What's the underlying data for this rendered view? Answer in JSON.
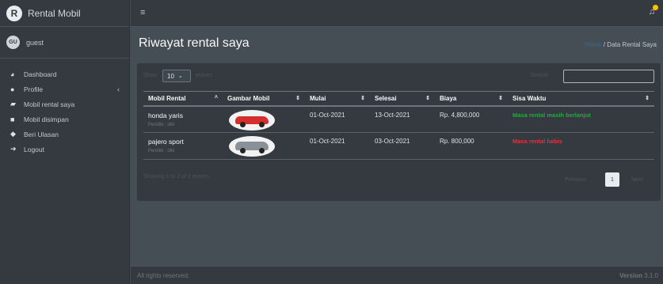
{
  "brand": {
    "name": "Rental Mobil",
    "logo_letter": "R"
  },
  "user": {
    "initials": "GU",
    "name": "guest"
  },
  "sidebar": {
    "items": [
      {
        "label": "Dashboard",
        "icon": "tachometer-icon"
      },
      {
        "label": "Profile",
        "icon": "user-icon",
        "arrow": "‹"
      },
      {
        "label": "Mobil rental saya",
        "icon": "car-icon"
      },
      {
        "label": "Mobil disimpan",
        "icon": "bookmark-icon"
      },
      {
        "label": "Beri Ulasan",
        "icon": "comments-icon"
      },
      {
        "label": "Logout",
        "icon": "sign-out-icon"
      }
    ]
  },
  "topbar": {
    "menu_icon": "≡",
    "bell_icon": "bell-icon"
  },
  "header": {
    "title": "Riwayat rental saya",
    "breadcrumb_home": "Home",
    "breadcrumb_sep": "/",
    "breadcrumb_current": "Data Rental Saya"
  },
  "table_controls": {
    "length_label": "Show",
    "length_value": "10",
    "length_after": "entries",
    "search_label": "Search:"
  },
  "table": {
    "columns": [
      "Mobil Rental",
      "Gambar Mobil",
      "Mulai",
      "Selesai",
      "Biaya",
      "Sisa Waktu"
    ],
    "rows": [
      {
        "name": "honda yaris",
        "owner": "Pemilik : diki",
        "start": "01-Oct-2021",
        "end": "13-Oct-2021",
        "cost": "Rp. 4,800,000",
        "status": "Masa rental masih berlanjut"
      },
      {
        "name": "pajero sport",
        "owner": "Pemilik : diki",
        "start": "01-Oct-2021",
        "end": "03-Oct-2021",
        "cost": "Rp. 800,000",
        "status": "Masa rental habis"
      }
    ],
    "info": "Showing 1 to 2 of 2 entries"
  },
  "pagination": {
    "previous": "Previous",
    "page": "1",
    "next": "Next"
  },
  "footer": {
    "left": "All rights reserved.",
    "version_label": "Version",
    "version_value": "3.1.0"
  },
  "colors": {
    "status_ok": "#28a745",
    "status_bad": "#dc3545",
    "link": "#3f6791"
  }
}
